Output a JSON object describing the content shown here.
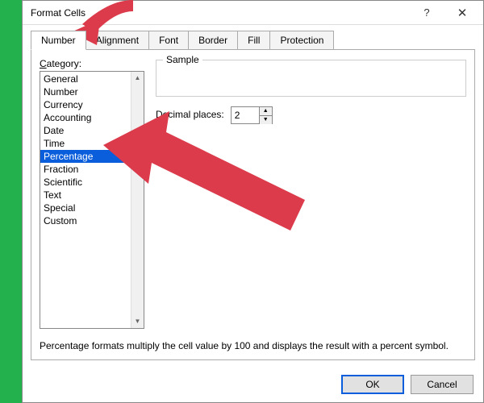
{
  "window": {
    "title": "Format Cells"
  },
  "tabs": {
    "items": [
      "Number",
      "Alignment",
      "Font",
      "Border",
      "Fill",
      "Protection"
    ],
    "active_index": 0
  },
  "category": {
    "label": "Category:",
    "items": [
      "General",
      "Number",
      "Currency",
      "Accounting",
      "Date",
      "Time",
      "Percentage",
      "Fraction",
      "Scientific",
      "Text",
      "Special",
      "Custom"
    ],
    "selected_index": 6
  },
  "sample": {
    "label": "Sample"
  },
  "decimal": {
    "label": "Decimal places:",
    "value": "2"
  },
  "description": "Percentage formats multiply the cell value by 100 and displays the result with a percent symbol.",
  "footer": {
    "ok": "OK",
    "cancel": "Cancel"
  },
  "icons": {
    "help": "?",
    "close": "✕",
    "up": "▲",
    "down": "▼"
  }
}
